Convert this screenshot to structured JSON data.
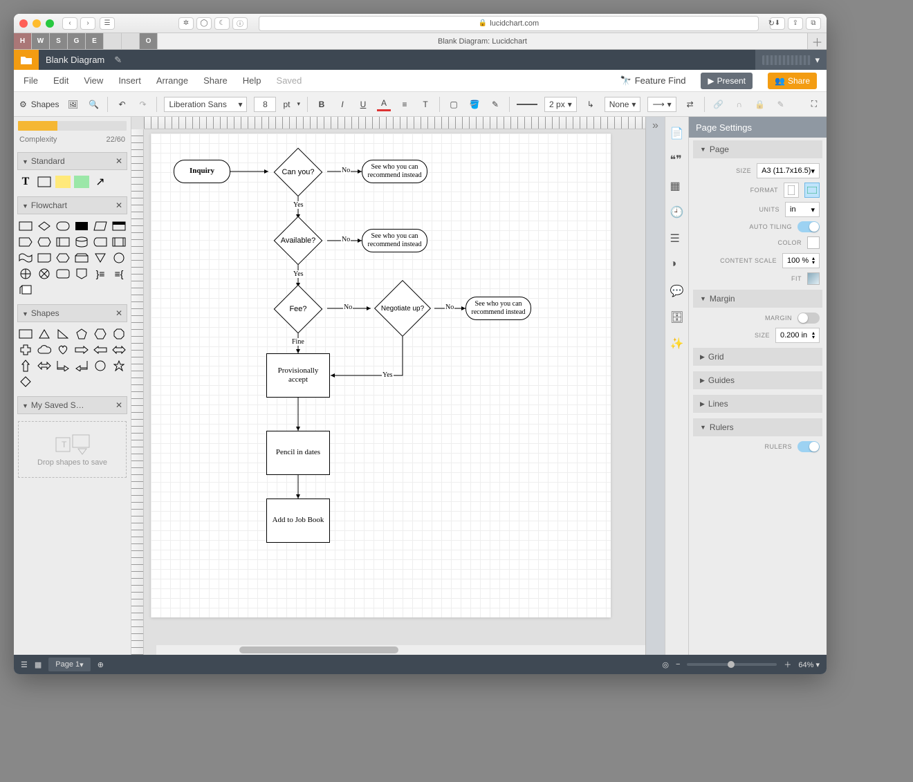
{
  "browser": {
    "url_host": "lucidchart.com",
    "tab_title": "Blank Diagram: Lucidchart",
    "favorites": [
      "H",
      "W",
      "S",
      "G",
      "E",
      "",
      "",
      "O"
    ]
  },
  "header": {
    "doc_title": "Blank Diagram"
  },
  "menu": {
    "items": [
      "File",
      "Edit",
      "View",
      "Insert",
      "Arrange",
      "Share",
      "Help"
    ],
    "status": "Saved",
    "feature_find": "Feature Find",
    "present": "Present",
    "share": "Share"
  },
  "toolbar": {
    "shapes": "Shapes",
    "font": "Liberation Sans",
    "font_size": "8",
    "font_unit": "pt",
    "line_w": "2 px",
    "line_style_none": "None"
  },
  "left_panel": {
    "complexity_label": "Complexity",
    "complexity_score": "22/60",
    "sections": {
      "standard": "Standard",
      "flowchart": "Flowchart",
      "shapes": "Shapes",
      "saved": "My Saved S…"
    },
    "drop_hint": "Drop shapes to save"
  },
  "canvas": {
    "nodes": {
      "inquiry": "Inquiry",
      "can_you": "Can you?",
      "recommend": "See who you can recommend instead",
      "available": "Available?",
      "fee": "Fee?",
      "negotiate": "Negotiate up?",
      "prov_accept": "Provisionally accept",
      "pencil": "Pencil in dates",
      "jobbook": "Add to Job Book"
    },
    "labels": {
      "no": "No",
      "yes": "Yes",
      "fine": "Fine"
    }
  },
  "right_panel": {
    "title": "Page Settings",
    "page": "Page",
    "size_label": "SIZE",
    "size_value": "A3 (11.7x16.5)",
    "format_label": "FORMAT",
    "units_label": "UNITS",
    "units_value": "in",
    "autotiling_label": "AUTO TILING",
    "color_label": "COLOR",
    "contentscale_label": "CONTENT SCALE",
    "contentscale_value": "100 %",
    "fit_label": "FIT",
    "margin": "Margin",
    "margin_label": "MARGIN",
    "margin_size_label": "SIZE",
    "margin_size_value": "0.200 in",
    "grid": "Grid",
    "guides": "Guides",
    "lines": "Lines",
    "rulers": "Rulers",
    "rulers_label": "RULERS"
  },
  "bottom": {
    "page": "Page 1",
    "zoom": "64%"
  }
}
